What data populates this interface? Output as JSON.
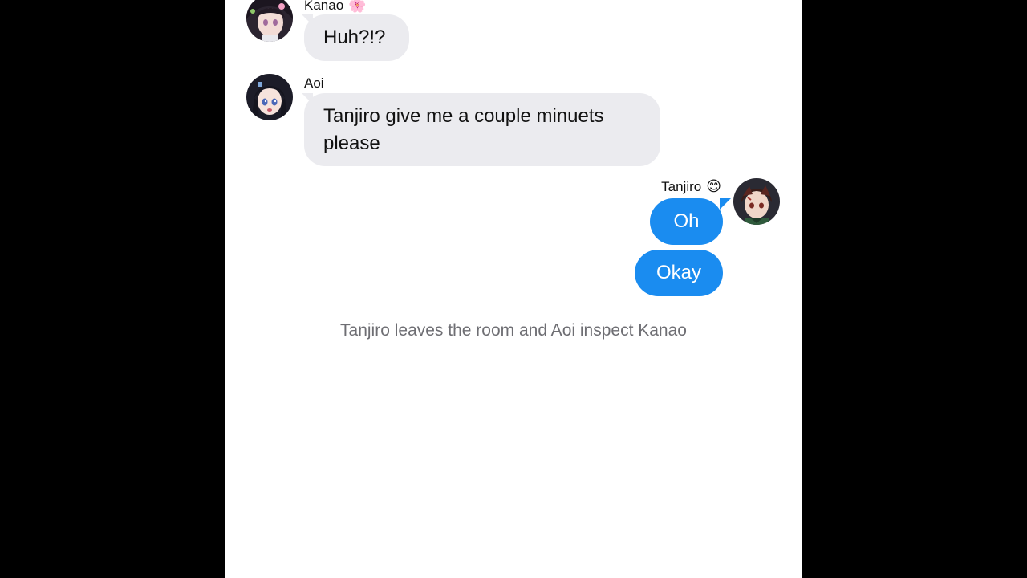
{
  "messages": [
    {
      "sender": "Kanao",
      "sender_emoji": "🌸",
      "text": "Huh?!?",
      "side": "left",
      "avatar": "kanao-avatar"
    },
    {
      "sender": "Aoi",
      "sender_emoji": "",
      "text": "Tanjiro give me a couple minuets please",
      "side": "left",
      "avatar": "aoi-avatar"
    },
    {
      "sender": "Tanjiro",
      "sender_emoji": "😊",
      "text": "Oh",
      "side": "right",
      "avatar": "tanjiro-avatar"
    },
    {
      "sender": "Tanjiro",
      "sender_emoji": "",
      "text": "Okay",
      "side": "right",
      "avatar": ""
    }
  ],
  "narration": "Tanjiro leaves the room and Aoi inspect Kanao",
  "colors": {
    "incoming_bubble": "#ebebef",
    "outgoing_bubble": "#1a8cf0",
    "narration": "#6e6e73"
  }
}
